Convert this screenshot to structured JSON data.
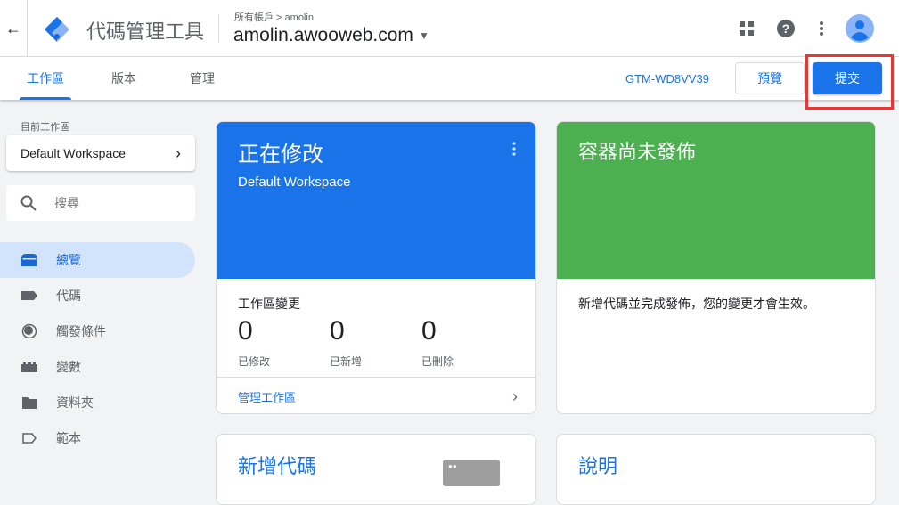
{
  "header": {
    "app_title": "代碼管理工具",
    "breadcrumb": "所有帳戶 > amolin",
    "account": "amolin.awooweb.com"
  },
  "subnav": {
    "tabs": [
      {
        "label": "工作區",
        "active": true
      },
      {
        "label": "版本"
      },
      {
        "label": "管理"
      }
    ],
    "container_id": "GTM-WD8VV39",
    "preview_label": "預覽",
    "submit_label": "提交"
  },
  "sidebar": {
    "section_label": "目前工作區",
    "workspace": "Default Workspace",
    "search_placeholder": "搜尋",
    "items": [
      {
        "label": "總覽",
        "icon": "overview-icon",
        "active": true
      },
      {
        "label": "代碼",
        "icon": "tag-icon"
      },
      {
        "label": "觸發條件",
        "icon": "trigger-icon"
      },
      {
        "label": "變數",
        "icon": "variable-icon"
      },
      {
        "label": "資料夾",
        "icon": "folder-icon"
      },
      {
        "label": "範本",
        "icon": "template-icon"
      }
    ]
  },
  "cards": {
    "editing": {
      "title": "正在修改",
      "subtitle": "Default Workspace",
      "changes_title": "工作區變更",
      "stats": [
        {
          "value": "0",
          "label": "已修改"
        },
        {
          "value": "0",
          "label": "已新增"
        },
        {
          "value": "0",
          "label": "已刪除"
        }
      ],
      "link": "管理工作區"
    },
    "unpublished": {
      "title": "容器尚未發佈",
      "body": "新增代碼並完成發佈，您的變更才會生效。"
    },
    "new_tag": {
      "title": "新增代碼"
    },
    "help": {
      "title": "說明"
    }
  },
  "colors": {
    "accent": "#1a73e8",
    "published_card": "#4caf50",
    "highlight": "#e53935"
  }
}
